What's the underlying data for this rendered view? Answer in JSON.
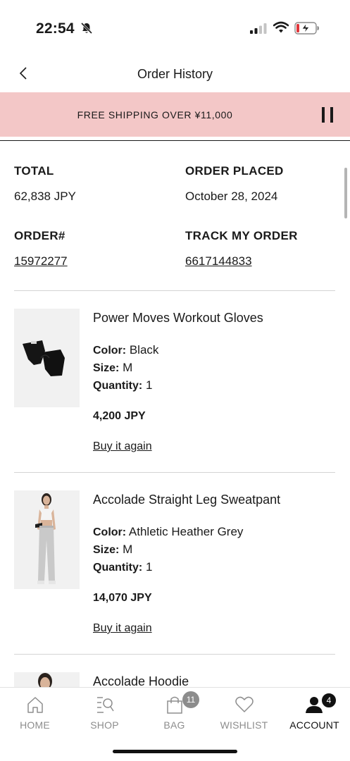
{
  "status_bar": {
    "time": "22:54"
  },
  "header": {
    "title": "Order History"
  },
  "promo": {
    "text": "FREE SHIPPING OVER ¥11,000"
  },
  "order": {
    "total_label": "TOTAL",
    "total_value": "62,838 JPY",
    "placed_label": "ORDER PLACED",
    "placed_value": "October 28, 2024",
    "number_label": "ORDER#",
    "number_value": "15972277",
    "track_label": "TRACK MY ORDER",
    "track_value": "6617144833"
  },
  "items": [
    {
      "name": "Power Moves Workout Gloves",
      "color_label": "Color:",
      "color": "Black",
      "size_label": "Size:",
      "size": "M",
      "qty_label": "Quantity:",
      "qty": "1",
      "price": "4,200 JPY",
      "action": "Buy it again"
    },
    {
      "name": "Accolade Straight Leg Sweatpant",
      "color_label": "Color:",
      "color": "Athletic Heather Grey",
      "size_label": "Size:",
      "size": "M",
      "qty_label": "Quantity:",
      "qty": "1",
      "price": "14,070 JPY",
      "action": "Buy it again"
    },
    {
      "name": "Accolade Hoodie"
    }
  ],
  "tabs": [
    {
      "label": "HOME",
      "icon": "home-icon"
    },
    {
      "label": "SHOP",
      "icon": "shop-search-icon"
    },
    {
      "label": "BAG",
      "icon": "bag-icon",
      "badge": "11"
    },
    {
      "label": "WISHLIST",
      "icon": "heart-icon"
    },
    {
      "label": "ACCOUNT",
      "icon": "account-icon",
      "badge": "4",
      "active": true
    }
  ],
  "colors": {
    "promo_bg": "#f3c7c7",
    "badge_bag": "#8c8c8c",
    "badge_account": "#111111",
    "text": "#1a1a1a"
  }
}
